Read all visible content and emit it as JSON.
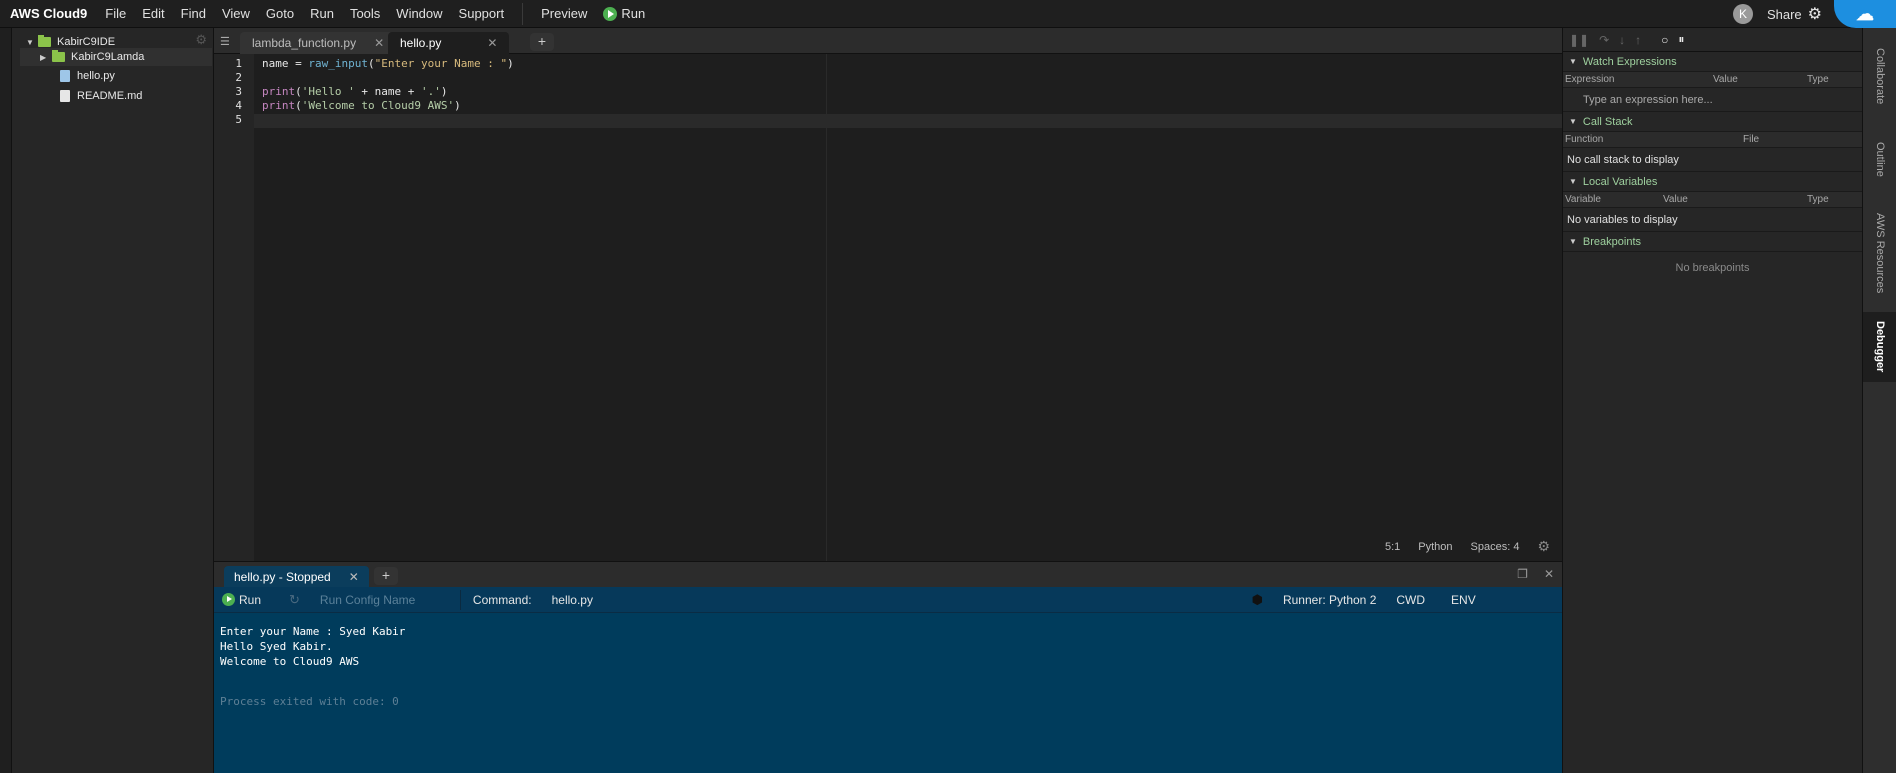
{
  "menubar": {
    "brand": "AWS Cloud9",
    "items": [
      "File",
      "Edit",
      "Find",
      "View",
      "Goto",
      "Run",
      "Tools",
      "Window",
      "Support"
    ],
    "preview": "Preview",
    "run": "Run",
    "avatar_letter": "K",
    "share": "Share"
  },
  "tree": {
    "root": "KabirC9IDE",
    "items": [
      {
        "label": "KabirC9Lamda",
        "type": "folder"
      },
      {
        "label": "hello.py",
        "type": "file"
      },
      {
        "label": "README.md",
        "type": "file"
      }
    ]
  },
  "editor": {
    "tabs": [
      {
        "label": "lambda_function.py",
        "active": false
      },
      {
        "label": "hello.py",
        "active": true
      }
    ],
    "line_numbers": [
      "1",
      "2",
      "3",
      "4",
      "5"
    ],
    "code": {
      "l1_var": "name",
      "l1_eq": " = ",
      "l1_fn": "raw_input",
      "l1_open": "(",
      "l1_str": "\"Enter your Name : \"",
      "l1_close": ")",
      "l3_kw": "print",
      "l3_open": "(",
      "l3_str": "'Hello '",
      "l3_mid": " + name + ",
      "l3_str2": "'.'",
      "l3_close": ")",
      "l4_kw": "print",
      "l4_open": "(",
      "l4_str": "'Welcome to Cloud9 AWS'",
      "l4_close": ")"
    },
    "status": {
      "cursor": "5:1",
      "language": "Python",
      "spaces": "Spaces: 4"
    }
  },
  "terminal": {
    "tab_label": "hello.py - Stopped",
    "run_label": "Run",
    "config_placeholder": "Run Config Name",
    "command_label": "Command:",
    "command_value": "hello.py",
    "runner": "Runner: Python 2",
    "cwd": "CWD",
    "env": "ENV",
    "output": [
      "Enter your Name : Syed Kabir",
      "Hello Syed Kabir.",
      "Welcome to Cloud9 AWS"
    ],
    "exit_line": "Process exited with code: 0"
  },
  "debugger": {
    "watch": {
      "title": "Watch Expressions",
      "cols": [
        "Expression",
        "Value",
        "Type"
      ],
      "placeholder": "Type an expression here..."
    },
    "callstack": {
      "title": "Call Stack",
      "cols": [
        "Function",
        "File"
      ],
      "message": "No call stack to display"
    },
    "locals": {
      "title": "Local Variables",
      "cols": [
        "Variable",
        "Value",
        "Type"
      ],
      "message": "No variables to display"
    },
    "breakpoints": {
      "title": "Breakpoints",
      "message": "No breakpoints"
    }
  },
  "side_tabs": [
    "Collaborate",
    "Outline",
    "AWS Resources",
    "Debugger"
  ],
  "colors": {
    "accent": "#1d8fe0",
    "run_green": "#4caf50",
    "terminal_bg": "#003c5c",
    "folder_green": "#8bc34a"
  }
}
